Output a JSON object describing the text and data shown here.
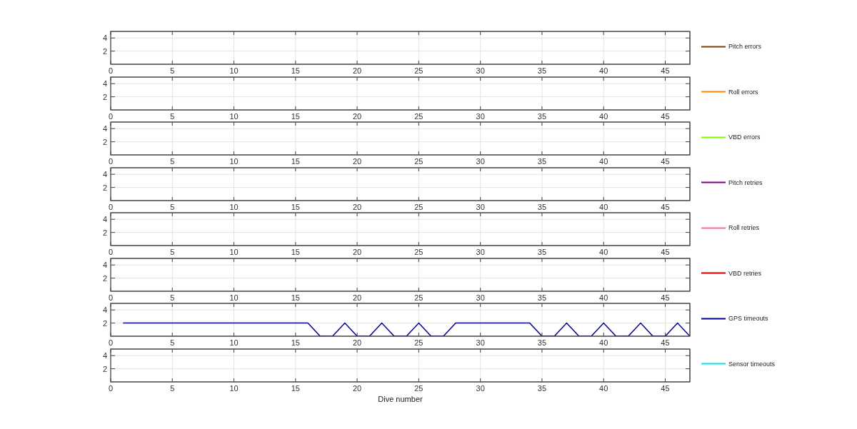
{
  "charts": [
    {
      "axes": {
        "xticks": [
          "0",
          "5",
          "10",
          "15",
          "20",
          "25",
          "30",
          "35",
          "40",
          "45"
        ],
        "yticks": [
          "4",
          "2"
        ]
      },
      "legend": {
        "label": "Pitch errors",
        "color": "#7f3f00"
      }
    },
    {
      "axes": {
        "xticks": [
          "0",
          "5",
          "10",
          "15",
          "20",
          "25",
          "30",
          "35",
          "40",
          "45"
        ],
        "yticks": [
          "4",
          "2"
        ]
      },
      "legend": {
        "label": "Roll errors",
        "color": "#ff8c00"
      }
    },
    {
      "axes": {
        "xticks": [
          "0",
          "5",
          "10",
          "15",
          "20",
          "25",
          "30",
          "35",
          "40",
          "45"
        ],
        "yticks": [
          "4",
          "2"
        ]
      },
      "legend": {
        "label": "VBD errors",
        "color": "#80ff00"
      }
    },
    {
      "axes": {
        "xticks": [
          "0",
          "5",
          "10",
          "15",
          "20",
          "25",
          "30",
          "35",
          "40",
          "45"
        ],
        "yticks": [
          "4",
          "2"
        ]
      },
      "legend": {
        "label": "Pitch retries",
        "color": "#800080"
      }
    },
    {
      "axes": {
        "xticks": [
          "0",
          "5",
          "10",
          "15",
          "20",
          "25",
          "30",
          "35",
          "40",
          "45"
        ],
        "yticks": [
          "4",
          "2"
        ]
      },
      "legend": {
        "label": "Roll retries",
        "color": "#ff69b4"
      }
    },
    {
      "axes": {
        "xticks": [
          "0",
          "5",
          "10",
          "15",
          "20",
          "25",
          "30",
          "35",
          "40",
          "45"
        ],
        "yticks": [
          "4",
          "2"
        ]
      },
      "legend": {
        "label": "VBD retries",
        "color": "#cc0000"
      }
    },
    {
      "chart_data": {
        "type": "line",
        "grid": true,
        "xlim": [
          0,
          47
        ],
        "ylim": [
          0,
          5
        ],
        "xticks": [
          0,
          5,
          10,
          15,
          20,
          25,
          30,
          35,
          40,
          45
        ],
        "yticks": [
          2,
          4
        ],
        "x": [
          1,
          2,
          3,
          4,
          5,
          6,
          7,
          8,
          9,
          10,
          11,
          12,
          13,
          14,
          15,
          16,
          17,
          18,
          19,
          20,
          21,
          22,
          23,
          24,
          25,
          26,
          27,
          28,
          29,
          30,
          31,
          32,
          33,
          34,
          35,
          36,
          37,
          38,
          39,
          40,
          41,
          42,
          43,
          44,
          45,
          46,
          47
        ],
        "series": [
          {
            "name": "GPS timeouts",
            "color": "#00008b",
            "values": [
              2,
              2,
              2,
              2,
              2,
              2,
              2,
              2,
              2,
              2,
              2,
              2,
              2,
              2,
              2,
              2,
              0,
              0,
              2,
              0,
              0,
              2,
              0,
              0,
              2,
              0,
              0,
              2,
              2,
              2,
              2,
              2,
              2,
              2,
              0,
              0,
              2,
              0,
              0,
              2,
              0,
              0,
              2,
              0,
              0,
              2,
              0
            ]
          }
        ]
      }
    },
    {
      "axes": {
        "xticks": [
          "0",
          "5",
          "10",
          "15",
          "20",
          "25",
          "30",
          "35",
          "40",
          "45"
        ],
        "yticks": [
          "4",
          "2"
        ],
        "xlabel": "Dive number"
      },
      "legend": {
        "label": "Sensor timeouts",
        "color": "#00e5ee"
      }
    }
  ]
}
